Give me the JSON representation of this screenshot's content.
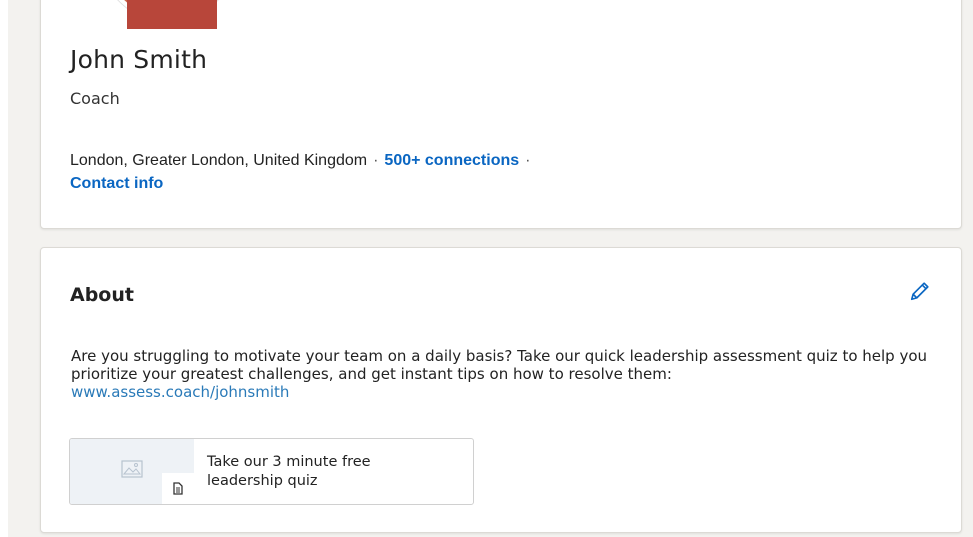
{
  "profile": {
    "name": "John Smith",
    "headline": "Coach",
    "location": "London, Greater London, United Kingdom",
    "separator": "·",
    "connections": "500+ connections",
    "contact_info": "Contact info"
  },
  "about": {
    "title": "About",
    "edit_icon": "pencil-icon",
    "text": "Are you struggling to motivate your team on a daily basis? Take our quick leadership assessment quiz to help you prioritize your greatest challenges, and get instant tips on how to resolve them:",
    "url": "www.assess.coach/johnsmith",
    "media": {
      "title": "Take our 3 minute free leadership quiz",
      "thumb_icon": "image-placeholder-icon",
      "badge_icon": "document-icon"
    }
  },
  "colors": {
    "link": "#0a66c2",
    "url": "#2a7ab8",
    "background": "#f3f2ef"
  }
}
